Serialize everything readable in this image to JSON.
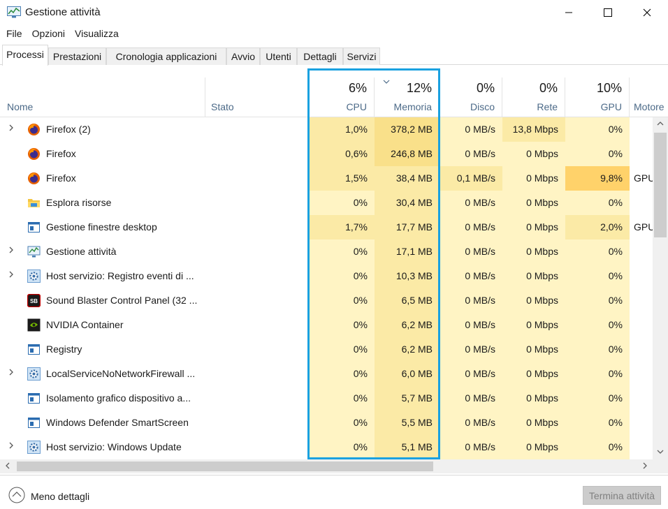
{
  "window": {
    "title": "Gestione attività"
  },
  "menu": [
    "File",
    "Opzioni",
    "Visualizza"
  ],
  "tabs": [
    "Processi",
    "Prestazioni",
    "Cronologia applicazioni",
    "Avvio",
    "Utenti",
    "Dettagli",
    "Servizi"
  ],
  "active_tab": "Processi",
  "columns": {
    "name": "Nome",
    "status": "Stato",
    "cpu": {
      "pct": "6%",
      "label": "CPU"
    },
    "memory": {
      "pct": "12%",
      "label": "Memoria"
    },
    "disk": {
      "pct": "0%",
      "label": "Disco"
    },
    "network": {
      "pct": "0%",
      "label": "Rete"
    },
    "gpu": {
      "pct": "10%",
      "label": "GPU"
    },
    "gpu_engine": {
      "label": "Motore"
    }
  },
  "processes": [
    {
      "name": "Firefox (2)",
      "icon": "firefox-icon",
      "expandable": true,
      "cpu": "1,0%",
      "memory": "378,2 MB",
      "disk": "0 MB/s",
      "network": "13,8 Mbps",
      "gpu": "0%",
      "engine": ""
    },
    {
      "name": "Firefox",
      "icon": "firefox-icon",
      "expandable": false,
      "cpu": "0,6%",
      "memory": "246,8 MB",
      "disk": "0 MB/s",
      "network": "0 Mbps",
      "gpu": "0%",
      "engine": ""
    },
    {
      "name": "Firefox",
      "icon": "firefox-icon",
      "expandable": false,
      "cpu": "1,5%",
      "memory": "38,4 MB",
      "disk": "0,1 MB/s",
      "network": "0 Mbps",
      "gpu": "9,8%",
      "engine": "GPU"
    },
    {
      "name": "Esplora risorse",
      "icon": "folder-icon",
      "expandable": false,
      "cpu": "0%",
      "memory": "30,4 MB",
      "disk": "0 MB/s",
      "network": "0 Mbps",
      "gpu": "0%",
      "engine": ""
    },
    {
      "name": "Gestione finestre desktop",
      "icon": "window-icon",
      "expandable": false,
      "cpu": "1,7%",
      "memory": "17,7 MB",
      "disk": "0 MB/s",
      "network": "0 Mbps",
      "gpu": "2,0%",
      "engine": "GPU"
    },
    {
      "name": "Gestione attività",
      "icon": "task-manager-icon",
      "expandable": true,
      "cpu": "0%",
      "memory": "17,1 MB",
      "disk": "0 MB/s",
      "network": "0 Mbps",
      "gpu": "0%",
      "engine": ""
    },
    {
      "name": "Host servizio: Registro eventi di ...",
      "icon": "gear-icon",
      "expandable": true,
      "cpu": "0%",
      "memory": "10,3 MB",
      "disk": "0 MB/s",
      "network": "0 Mbps",
      "gpu": "0%",
      "engine": ""
    },
    {
      "name": "Sound Blaster Control Panel (32 ...",
      "icon": "sound-blaster-icon",
      "expandable": false,
      "cpu": "0%",
      "memory": "6,5 MB",
      "disk": "0 MB/s",
      "network": "0 Mbps",
      "gpu": "0%",
      "engine": ""
    },
    {
      "name": "NVIDIA Container",
      "icon": "nvidia-icon",
      "expandable": false,
      "cpu": "0%",
      "memory": "6,2 MB",
      "disk": "0 MB/s",
      "network": "0 Mbps",
      "gpu": "0%",
      "engine": ""
    },
    {
      "name": "Registry",
      "icon": "window-icon",
      "expandable": false,
      "cpu": "0%",
      "memory": "6,2 MB",
      "disk": "0 MB/s",
      "network": "0 Mbps",
      "gpu": "0%",
      "engine": ""
    },
    {
      "name": "LocalServiceNoNetworkFirewall ...",
      "icon": "gear-icon",
      "expandable": true,
      "cpu": "0%",
      "memory": "6,0 MB",
      "disk": "0 MB/s",
      "network": "0 Mbps",
      "gpu": "0%",
      "engine": ""
    },
    {
      "name": "Isolamento grafico dispositivo a...",
      "icon": "window-icon",
      "expandable": false,
      "cpu": "0%",
      "memory": "5,7 MB",
      "disk": "0 MB/s",
      "network": "0 Mbps",
      "gpu": "0%",
      "engine": ""
    },
    {
      "name": "Windows Defender SmartScreen",
      "icon": "window-icon",
      "expandable": false,
      "cpu": "0%",
      "memory": "5,5 MB",
      "disk": "0 MB/s",
      "network": "0 Mbps",
      "gpu": "0%",
      "engine": ""
    },
    {
      "name": "Host servizio: Windows Update",
      "icon": "gear-icon",
      "expandable": true,
      "cpu": "0%",
      "memory": "5,1 MB",
      "disk": "0 MB/s",
      "network": "0 Mbps",
      "gpu": "0%",
      "engine": ""
    }
  ],
  "footer": {
    "less_details": "Meno dettagli",
    "end_task": "Termina attività"
  },
  "colors": {
    "highlight_border": "#1aa1e0",
    "heat_light": "#fff4c4",
    "heat_medium": "#fbeaa6",
    "heat_strong": "#f9e08a",
    "heat_gpu_high": "#ffd26a"
  }
}
